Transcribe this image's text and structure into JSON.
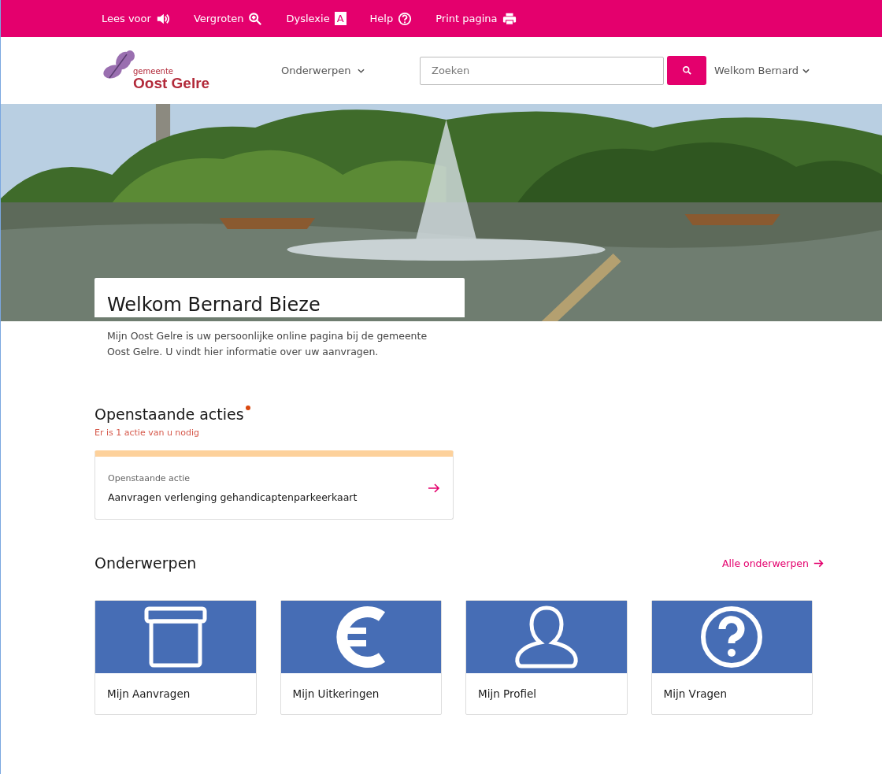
{
  "toolbar": [
    {
      "label": "Lees voor",
      "kind": "speaker"
    },
    {
      "label": "Vergroten",
      "kind": "zoom"
    },
    {
      "label": "Dyslexie",
      "kind": "letter",
      "icon_text": "A"
    },
    {
      "label": "Help",
      "kind": "help"
    },
    {
      "label": "Print pagina",
      "kind": "print"
    }
  ],
  "header": {
    "logo": {
      "small": "gemeente",
      "name": "Oost Gelre"
    },
    "menu": "Onderwerpen",
    "search": {
      "placeholder": "Zoeken"
    },
    "user": "Welkom Bernard"
  },
  "welcome": {
    "title": "Welkom Bernard Bieze",
    "intro": "Mijn Oost Gelre is uw persoonlijke online pagina bij de gemeente Oost Gelre. U vindt hier informatie over uw aanvragen."
  },
  "actions": {
    "title": "Openstaande acties",
    "unread": true,
    "note": "Er is 1 actie van u nodig",
    "items": [
      {
        "label": "Openstaande actie",
        "title": "Aanvragen verlenging gehandicaptenparkeerkaart"
      }
    ]
  },
  "topics": {
    "title": "Onderwerpen",
    "all_link": "Alle onderwerpen",
    "items": [
      {
        "label": "Mijn Aanvragen",
        "kind": "box"
      },
      {
        "label": "Mijn Uitkeringen",
        "kind": "euro"
      },
      {
        "label": "Mijn Profiel",
        "kind": "person"
      },
      {
        "label": "Mijn Vragen",
        "kind": "question"
      }
    ]
  }
}
